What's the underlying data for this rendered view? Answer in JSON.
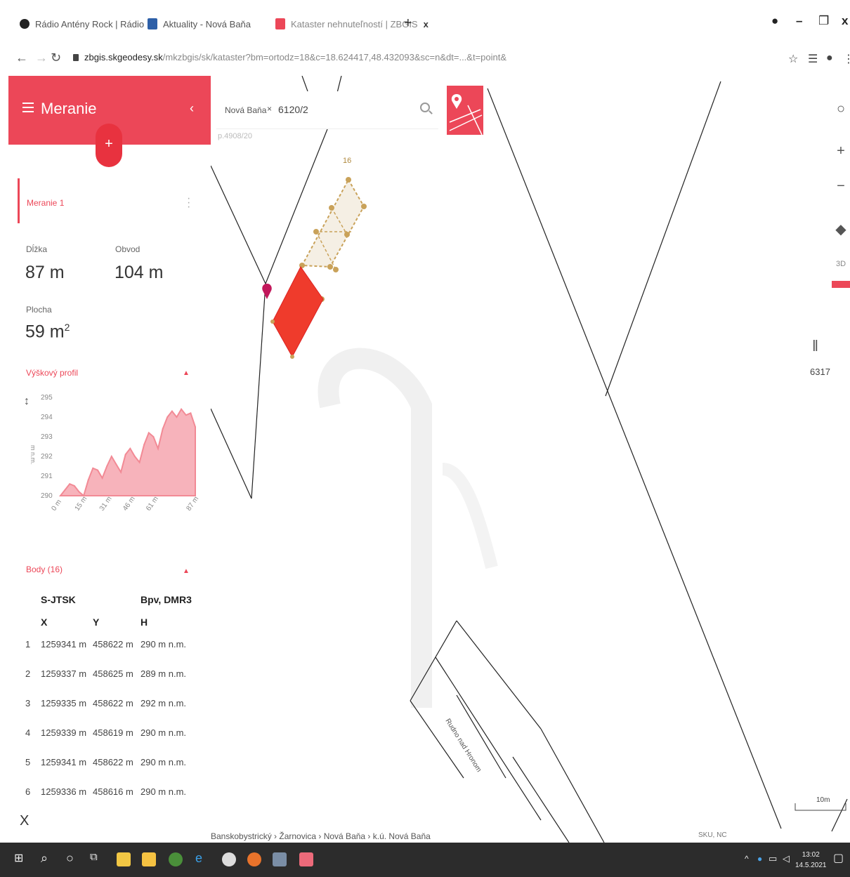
{
  "browser": {
    "tabs": [
      {
        "label": "Rádio Antény Rock | Rádio",
        "color": "#222222"
      },
      {
        "label": "Aktuality - Nová Baňa",
        "color": "#2d5fa8"
      },
      {
        "label": "Kataster nehnuteľností | ZBGIS",
        "color": "#ec4758"
      }
    ],
    "tab_close": "x",
    "new_tab": "+",
    "url_host": "zbgis.skgeodesy.sk",
    "url_path": "/mkzbgis/sk/kataster?bm=ortodz=18&c=18.624417,48.432093&sc=n&dt=...&t=point&"
  },
  "panel": {
    "title": "Meranie",
    "collapse": "‹",
    "add": "+",
    "measurement_name": "Meranie 1",
    "length_label": "Dĺžka",
    "length_value": "87 m",
    "perimeter_label": "Obvod",
    "perimeter_value": "104 m",
    "area_label": "Plocha",
    "area_value": "59 m",
    "area_sup": "2",
    "profile_title": "Výškový profil",
    "points_title": "Body (16)",
    "toggle": "▲",
    "close": "X"
  },
  "chart_data": {
    "type": "area",
    "title": "Výškový profil",
    "ylabel": "m n.m.",
    "y_ticks": [
      290,
      291,
      292,
      293,
      294,
      295
    ],
    "x_ticks": [
      "0 m",
      "15 m",
      "31 m",
      "46 m",
      "61 m",
      "87 m"
    ],
    "ylim": [
      290,
      295
    ],
    "xlim": [
      0,
      87
    ],
    "x": [
      0,
      3,
      6,
      9,
      12,
      15,
      18,
      21,
      24,
      27,
      30,
      33,
      36,
      39,
      42,
      45,
      48,
      51,
      54,
      57,
      60,
      63,
      66,
      69,
      72,
      75,
      78,
      81,
      84,
      87
    ],
    "values": [
      290.0,
      290.3,
      290.6,
      290.5,
      290.2,
      290.0,
      290.8,
      291.4,
      291.3,
      290.9,
      291.5,
      292.0,
      291.6,
      291.2,
      292.1,
      292.4,
      292.0,
      291.7,
      292.6,
      293.2,
      293.0,
      292.4,
      293.4,
      294.0,
      294.3,
      294.0,
      294.4,
      294.1,
      294.2,
      293.5
    ],
    "color": "#f28a95"
  },
  "points_table": {
    "header_system": "S-JTSK",
    "header_height": "Bpv, DMR3",
    "col_x": "X",
    "col_y": "Y",
    "col_h": "H",
    "rows": [
      {
        "n": "1",
        "x": "1259341 m",
        "y": "458622 m",
        "h": "290 m n.m."
      },
      {
        "n": "2",
        "x": "1259337 m",
        "y": "458625 m",
        "h": "289 m n.m."
      },
      {
        "n": "3",
        "x": "1259335 m",
        "y": "458622 m",
        "h": "292 m n.m."
      },
      {
        "n": "4",
        "x": "1259339 m",
        "y": "458619 m",
        "h": "290 m n.m."
      },
      {
        "n": "5",
        "x": "1259341 m",
        "y": "458622 m",
        "h": "290 m n.m."
      },
      {
        "n": "6",
        "x": "1259336 m",
        "y": "458616 m",
        "h": "290 m n.m."
      }
    ]
  },
  "map": {
    "search_chip": "Nová Baňa",
    "search_chip_x": "×",
    "search_value": "6120/2",
    "search_sub": "p.4908/20",
    "vertex_top_label": "16",
    "road_label": "Rudno nad Hronom",
    "parcel_label": "6317",
    "zoom_in": "+",
    "zoom_out": "−",
    "dim_label": "3D",
    "scale_label": "10m",
    "breadcrumb": "Banskobystrický › Žarnovica › Nová Baňa › k.ú. Nová Baňa",
    "attribution": "SKU, NC"
  },
  "taskbar": {
    "time": "13:02",
    "date": "14.5.2021"
  }
}
